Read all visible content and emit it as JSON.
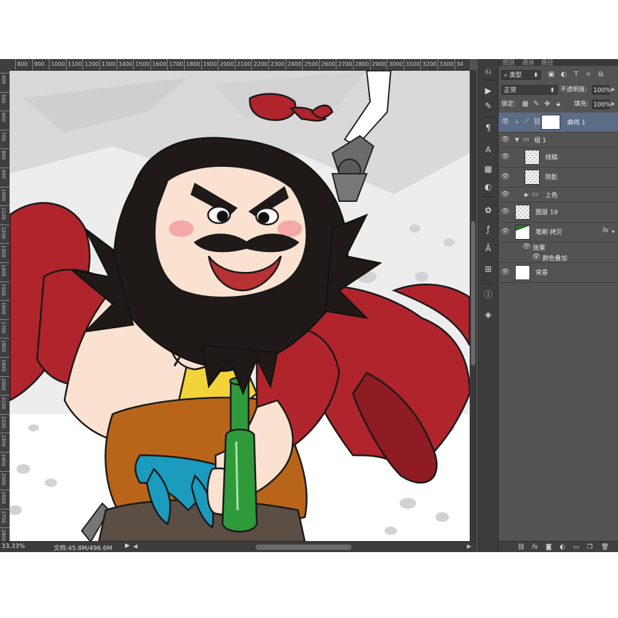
{
  "ruler": {
    "top": [
      "800",
      "900",
      "1000",
      "1100",
      "1200",
      "1300",
      "1400",
      "1500",
      "1600",
      "1700",
      "1800",
      "1900",
      "2000",
      "2100",
      "2200",
      "2300",
      "2400",
      "2500",
      "2600",
      "2700",
      "2800",
      "2900",
      "3000",
      "3100",
      "3200",
      "3300",
      "34"
    ],
    "left": [
      "400",
      "500",
      "600",
      "700",
      "800",
      "900",
      "1000",
      "1100",
      "1200",
      "1300",
      "1400",
      "1500",
      "1600",
      "1700",
      "1800",
      "1900",
      "2000",
      "2100",
      "2200",
      "2300",
      "2400",
      "2500",
      "2600",
      "2700",
      "2800"
    ]
  },
  "status": {
    "zoom": "33.33%",
    "document": "文档:45.8M/496.6M"
  },
  "panel": {
    "tabs": [
      "图层",
      "通道",
      "路径"
    ],
    "filter_kind": "类型",
    "blend_mode": "正常",
    "opacity_label": "不透明度:",
    "opacity_value": "100%",
    "lock_label": "锁定:",
    "fill_label": "填充:",
    "fill_value": "100%"
  },
  "layers": [
    {
      "name": "曲线 1",
      "type": "adjustment",
      "selected": true
    },
    {
      "name": "组 1",
      "type": "group"
    },
    {
      "name": "线稿",
      "type": "pixel"
    },
    {
      "name": "阴影",
      "type": "pixel"
    },
    {
      "name": "上色",
      "type": "group"
    },
    {
      "name": "图层 19",
      "type": "pixel"
    },
    {
      "name": "笔刷 拷贝",
      "type": "pixel",
      "fx": "fx"
    },
    {
      "name": "效果",
      "type": "effects"
    },
    {
      "name": "颜色叠加",
      "type": "effect"
    },
    {
      "name": "背景",
      "type": "background"
    }
  ],
  "icons": {
    "tools": [
      "history-icon",
      "actions-icon",
      "brush-settings-icon",
      "paragraph-icon",
      "character-icon",
      "swatches-icon",
      "adjustments-icon",
      "styles-icon",
      "fx-icon",
      "text-icon",
      "align-icon",
      "info-icon",
      "3d-icon"
    ],
    "footer": [
      "link-icon",
      "fx-icon",
      "mask-icon",
      "adjustment-icon",
      "folder-icon",
      "new-layer-icon",
      "trash-icon"
    ]
  },
  "colors": {
    "panel_bg": "#535353",
    "selected_layer": "#5b6c86",
    "cape_red": "#b0242c",
    "sash_blue": "#1b9bbd",
    "bottle_green": "#2f9a3a",
    "vest_brown": "#b8651a"
  }
}
